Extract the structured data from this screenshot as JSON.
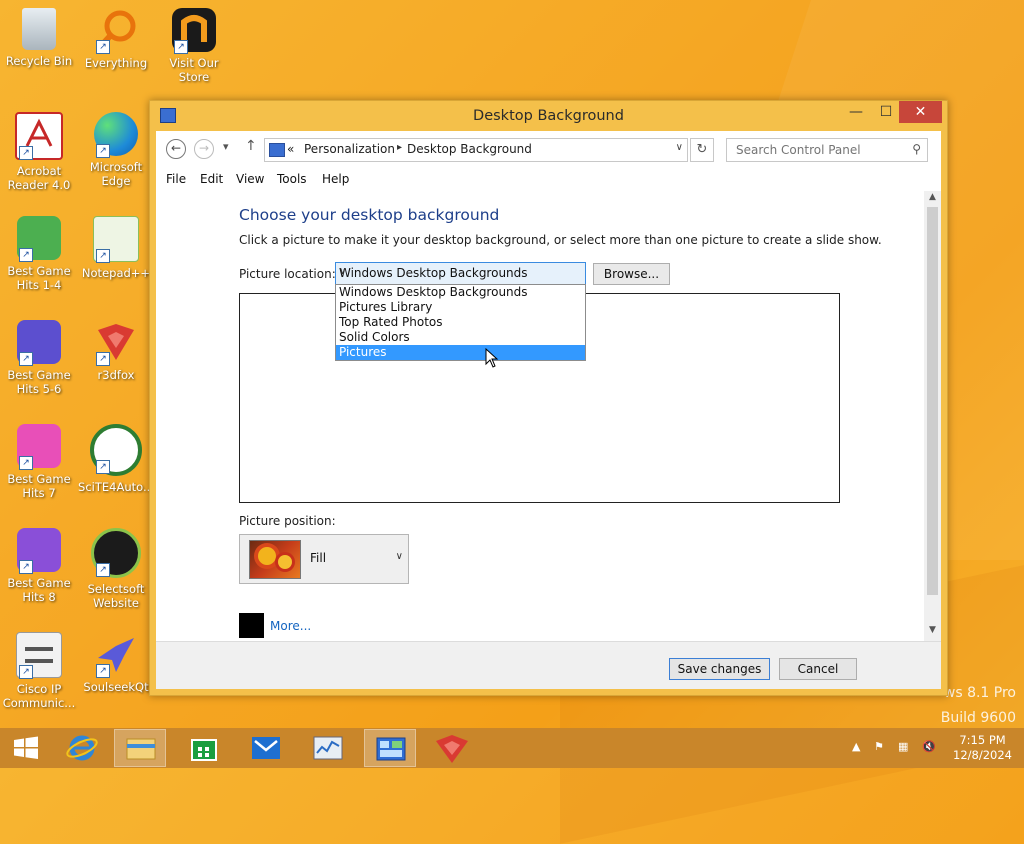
{
  "desktop": {
    "icons": [
      {
        "label": "Recycle Bin"
      },
      {
        "label": "Everything"
      },
      {
        "label": "Visit Our Store"
      },
      {
        "label": "Acrobat Reader 4.0"
      },
      {
        "label": "Microsoft Edge"
      },
      {
        "label": "Best Game Hits 1-4"
      },
      {
        "label": "Notepad++"
      },
      {
        "label": "Best Game Hits 5-6"
      },
      {
        "label": "r3dfox"
      },
      {
        "label": "Best Game Hits 7"
      },
      {
        "label": "SciTE4Auto..."
      },
      {
        "label": "Best Game Hits 8"
      },
      {
        "label": "Selectsoft Website"
      },
      {
        "label": "Cisco IP Communic..."
      },
      {
        "label": "SoulseekQt"
      }
    ],
    "watermark_line1": "ws 8.1 Pro",
    "watermark_line2": "Build 9600"
  },
  "window": {
    "title": "Desktop Background",
    "address": {
      "prefix": "«",
      "crumbs": [
        "Personalization",
        "Desktop Background"
      ]
    },
    "search_placeholder": "Search Control Panel",
    "menu": [
      "File",
      "Edit",
      "View",
      "Tools",
      "Help"
    ],
    "heading": "Choose your desktop background",
    "instructions": "Click a picture to make it your desktop background, or select more than one picture to create a slide show.",
    "picture_location_label": "Picture location:",
    "picture_location_value": "Windows Desktop Backgrounds",
    "browse_label": "Browse...",
    "location_options": [
      "Windows Desktop Backgrounds",
      "Pictures Library",
      "Top Rated Photos",
      "Solid Colors",
      "Pictures"
    ],
    "highlighted_option": "Pictures",
    "picture_position_label": "Picture position:",
    "picture_position_value": "Fill",
    "more_label": "More...",
    "save_label": "Save changes",
    "cancel_label": "Cancel"
  },
  "taskbar": {
    "time": "7:15 PM",
    "date": "12/8/2024"
  }
}
